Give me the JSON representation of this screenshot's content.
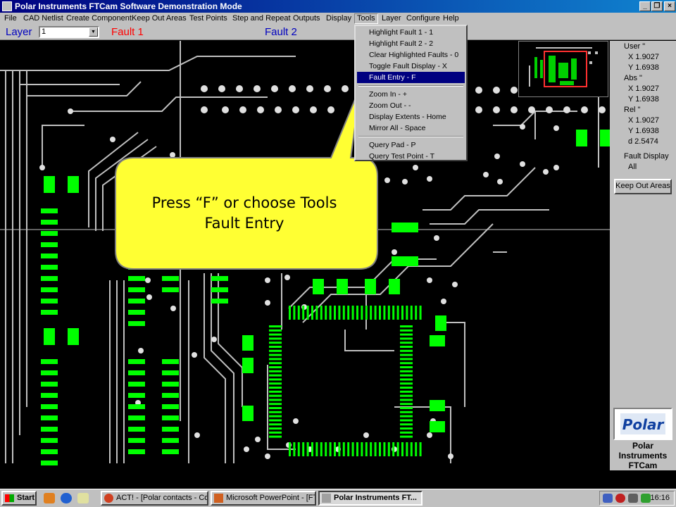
{
  "window": {
    "title": "Polar Instruments FTCam Software  Demonstration Mode"
  },
  "menubar": {
    "items": [
      "File",
      "CAD Netlist",
      "Create Component",
      "Keep Out Areas",
      "Test Points",
      "Step and Repeat",
      "Outputs",
      "Display",
      "Tools",
      "Layer",
      "Configure",
      "Help"
    ]
  },
  "layerbar": {
    "layer_label": "Layer",
    "layer_value": "1",
    "fault1_label": "Fault 1",
    "fault2_label": "Fault 2"
  },
  "tools_menu": {
    "items": [
      "Highlight Fault 1 - 1",
      "Highlight Fault 2 - 2",
      "Clear Highlighted Faults - 0",
      "Toggle Fault Display - X",
      "Fault Entry - F",
      "Zoom In - +",
      "Zoom Out - -",
      "Display Extents - Home",
      "Mirror All - Space",
      "Query Pad - P",
      "Query Test Point - T"
    ],
    "selected": "Fault Entry - F"
  },
  "rightpanel": {
    "user_label": "User \"",
    "user_x": "X 1.9027",
    "user_y": "Y 1.6938",
    "abs_label": "Abs \"",
    "abs_x": "X 1.9027",
    "abs_y": "Y 1.6938",
    "rel_label": "Rel \"",
    "rel_x": "X 1.9027",
    "rel_y": "Y 1.6938",
    "rel_d": "d 2.5474",
    "fault_display_label": "Fault Display",
    "fault_display_value": "All",
    "keepout_button": "Keep Out Areas",
    "logo_text": "Polar",
    "caption_line1": "Polar",
    "caption_line2": "Instruments",
    "caption_line3": "FTCam"
  },
  "callout": {
    "line1": "Press “F” or choose Tools",
    "line2": "Fault Entry"
  },
  "taskbar": {
    "start": "Start",
    "tasks": [
      "ACT! - [Polar contacts - Co...",
      "Microsoft PowerPoint - [FT...",
      "Polar Instruments FT..."
    ],
    "clock": "16:16"
  },
  "colors": {
    "pad_green": "#00ff00",
    "trace_gray": "#c0c0c0",
    "callout_yellow": "#ffff33",
    "menu_highlight": "#000080"
  }
}
